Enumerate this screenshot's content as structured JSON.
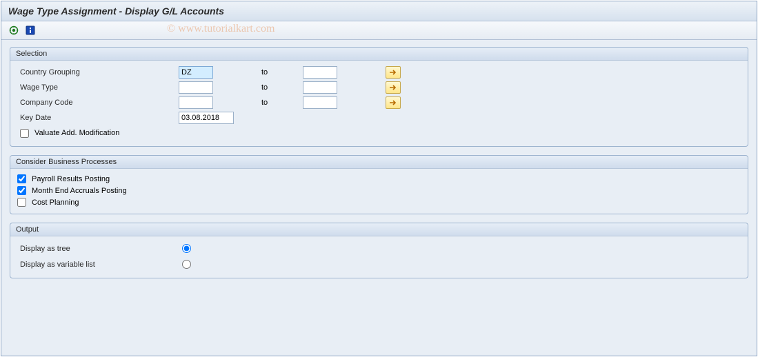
{
  "header": {
    "title": "Wage Type Assignment - Display G/L Accounts"
  },
  "watermark": "© www.tutorialkart.com",
  "toolbar": {
    "execute_icon": "execute-icon",
    "info_icon": "info-icon"
  },
  "selection": {
    "title": "Selection",
    "rows": {
      "country_grouping": {
        "label": "Country Grouping",
        "from": "DZ",
        "to_label": "to",
        "to": ""
      },
      "wage_type": {
        "label": "Wage Type",
        "from": "",
        "to_label": "to",
        "to": ""
      },
      "company_code": {
        "label": "Company Code",
        "from": "",
        "to_label": "to",
        "to": ""
      },
      "key_date": {
        "label": "Key Date",
        "value": "03.08.2018"
      }
    },
    "valuate_add_mod": {
      "label": "Valuate Add. Modification",
      "checked": false
    }
  },
  "processes": {
    "title": "Consider Business Processes",
    "payroll_results": {
      "label": "Payroll Results Posting",
      "checked": true
    },
    "month_end_accruals": {
      "label": "Month End Accruals Posting",
      "checked": true
    },
    "cost_planning": {
      "label": "Cost Planning",
      "checked": false
    }
  },
  "output": {
    "title": "Output",
    "tree": {
      "label": "Display as tree",
      "selected": true
    },
    "var_list": {
      "label": "Display as variable list",
      "selected": false
    }
  },
  "colors": {
    "accent_bg": "#e8eef5",
    "header_grad_top": "#eef3f8",
    "header_grad_bot": "#d6e1ee",
    "multiselect_btn_bg": "#ffe68a"
  }
}
